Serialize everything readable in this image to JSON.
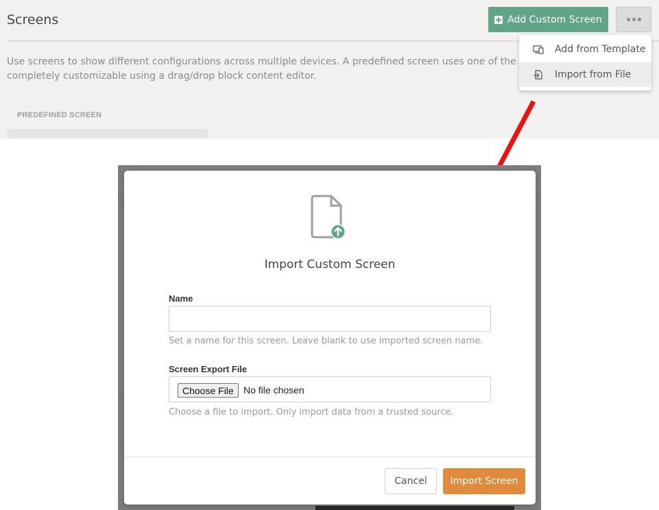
{
  "page": {
    "title": "Screens",
    "add_button_label": "Add Custom Screen",
    "add_button_icon": "plus-square-icon",
    "more_button_icon": "ellipsis-icon",
    "description_line1": "Use screens to show different configurations across multiple devices. A predefined screen uses one of the predefined lay",
    "description_line2": "completely customizable using a drag/drop block content editor.",
    "section_label": "PREDEFINED SCREEN"
  },
  "dropdown": {
    "items": [
      {
        "label": "Add from Template",
        "icon": "template-icon"
      },
      {
        "label": "Import from File",
        "icon": "file-import-icon"
      }
    ]
  },
  "modal": {
    "icon": "file-upload-icon",
    "title": "Import Custom Screen",
    "name_label": "Name",
    "name_value": "",
    "name_help": "Set a name for this screen. Leave blank to use imported screen name.",
    "file_label": "Screen Export File",
    "choose_file_label": "Choose File",
    "no_file_text": "No file chosen",
    "file_help": "Choose a file to import. Only import data from a trusted source.",
    "cancel_label": "Cancel",
    "import_label": "Import Screen"
  },
  "colors": {
    "primary_green": "#5fa586",
    "accent_orange": "#e08a3e",
    "annotation_arrow": "#ee1111"
  }
}
